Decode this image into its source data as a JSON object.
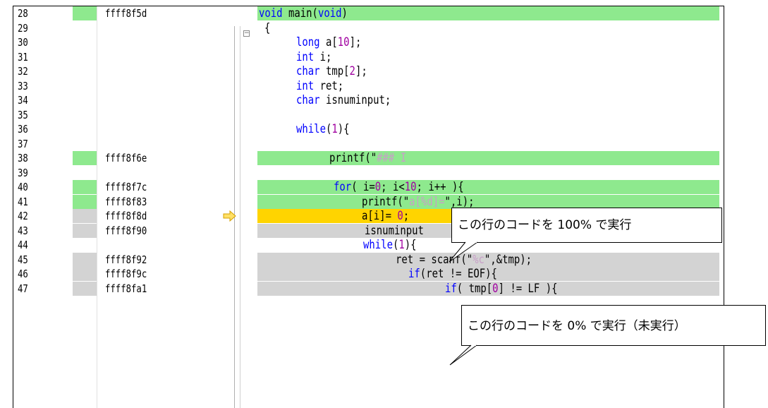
{
  "editor": {
    "lines": [
      {
        "num": "28",
        "addr": "ffff8f5d",
        "cov": "green",
        "hl": "green"
      },
      {
        "num": "29",
        "addr": "",
        "cov": "",
        "hl": ""
      },
      {
        "num": "30",
        "addr": "",
        "cov": "",
        "hl": ""
      },
      {
        "num": "31",
        "addr": "",
        "cov": "",
        "hl": ""
      },
      {
        "num": "32",
        "addr": "",
        "cov": "",
        "hl": ""
      },
      {
        "num": "33",
        "addr": "",
        "cov": "",
        "hl": ""
      },
      {
        "num": "34",
        "addr": "",
        "cov": "",
        "hl": ""
      },
      {
        "num": "35",
        "addr": "",
        "cov": "",
        "hl": ""
      },
      {
        "num": "36",
        "addr": "",
        "cov": "",
        "hl": ""
      },
      {
        "num": "37",
        "addr": "",
        "cov": "",
        "hl": ""
      },
      {
        "num": "38",
        "addr": "ffff8f6e",
        "cov": "green",
        "hl": "green"
      },
      {
        "num": "39",
        "addr": "",
        "cov": "",
        "hl": ""
      },
      {
        "num": "40",
        "addr": "ffff8f7c",
        "cov": "green",
        "hl": "green"
      },
      {
        "num": "41",
        "addr": "ffff8f83",
        "cov": "green",
        "hl": "green"
      },
      {
        "num": "42",
        "addr": "ffff8f8d",
        "cov": "gray",
        "hl": "yellow"
      },
      {
        "num": "43",
        "addr": "ffff8f90",
        "cov": "gray",
        "hl": "gray"
      },
      {
        "num": "44",
        "addr": "",
        "cov": "",
        "hl": ""
      },
      {
        "num": "45",
        "addr": "ffff8f92",
        "cov": "gray",
        "hl": "gray"
      },
      {
        "num": "46",
        "addr": "ffff8f9c",
        "cov": "gray",
        "hl": "gray"
      },
      {
        "num": "47",
        "addr": "ffff8fa1",
        "cov": "gray",
        "hl": "gray"
      }
    ],
    "code": [
      [
        {
          "t": "void",
          "c": "kw"
        },
        {
          "t": " main(",
          "c": ""
        },
        {
          "t": "void",
          "c": "kw"
        },
        {
          "t": ")",
          "c": ""
        }
      ],
      [
        {
          "t": "{",
          "c": ""
        }
      ],
      [
        {
          "t": "long",
          "c": "kw"
        },
        {
          "t": " a[",
          "c": ""
        },
        {
          "t": "10",
          "c": "num"
        },
        {
          "t": "];",
          "c": ""
        }
      ],
      [
        {
          "t": "int",
          "c": "kw"
        },
        {
          "t": " i;",
          "c": ""
        }
      ],
      [
        {
          "t": "char",
          "c": "kw"
        },
        {
          "t": " tmp[",
          "c": ""
        },
        {
          "t": "2",
          "c": "num"
        },
        {
          "t": "];",
          "c": ""
        }
      ],
      [
        {
          "t": "int",
          "c": "kw"
        },
        {
          "t": " ret;",
          "c": ""
        }
      ],
      [
        {
          "t": "char",
          "c": "kw"
        },
        {
          "t": " isnuminput;",
          "c": ""
        }
      ],
      [],
      [
        {
          "t": "while",
          "c": "kw"
        },
        {
          "t": "(",
          "c": ""
        },
        {
          "t": "1",
          "c": "num"
        },
        {
          "t": "){",
          "c": ""
        }
      ],
      [],
      [
        {
          "t": "printf(\"",
          "c": ""
        },
        {
          "t": "### I",
          "c": "str"
        }
      ],
      [],
      [
        {
          "t": "for",
          "c": "kw"
        },
        {
          "t": "( i=",
          "c": ""
        },
        {
          "t": "0",
          "c": "num"
        },
        {
          "t": "; i<",
          "c": ""
        },
        {
          "t": "10",
          "c": "num"
        },
        {
          "t": "; i++ ){",
          "c": ""
        }
      ],
      [
        {
          "t": "printf(\"",
          "c": ""
        },
        {
          "t": "a[%d]=",
          "c": "str"
        },
        {
          "t": "\",i);",
          "c": ""
        }
      ],
      [
        {
          "t": "a[i]= ",
          "c": ""
        },
        {
          "t": "0",
          "c": "num"
        },
        {
          "t": ";",
          "c": ""
        }
      ],
      [
        {
          "t": "isnuminput",
          "c": ""
        }
      ],
      [
        {
          "t": "while",
          "c": "kw"
        },
        {
          "t": "(",
          "c": ""
        },
        {
          "t": "1",
          "c": "num"
        },
        {
          "t": "){",
          "c": ""
        }
      ],
      [
        {
          "t": "ret = scanf(\"",
          "c": ""
        },
        {
          "t": "%c",
          "c": "str"
        },
        {
          "t": "\",&tmp);",
          "c": ""
        }
      ],
      [
        {
          "t": "if",
          "c": "kw"
        },
        {
          "t": "(ret != EOF){",
          "c": ""
        }
      ],
      [
        {
          "t": "if",
          "c": "kw"
        },
        {
          "t": "( tmp[",
          "c": ""
        },
        {
          "t": "0",
          "c": "num"
        },
        {
          "t": "] != LF ){",
          "c": ""
        }
      ]
    ],
    "current_line_arrow": "arrow-right-icon",
    "colors": {
      "executed": "#8ee98e",
      "not_executed": "#d3d3d3",
      "current": "#ffd400"
    }
  },
  "callouts": {
    "executed_label": "この行のコードを 100% で実行",
    "not_executed_label": "この行のコードを 0% で実行（未実行）"
  }
}
